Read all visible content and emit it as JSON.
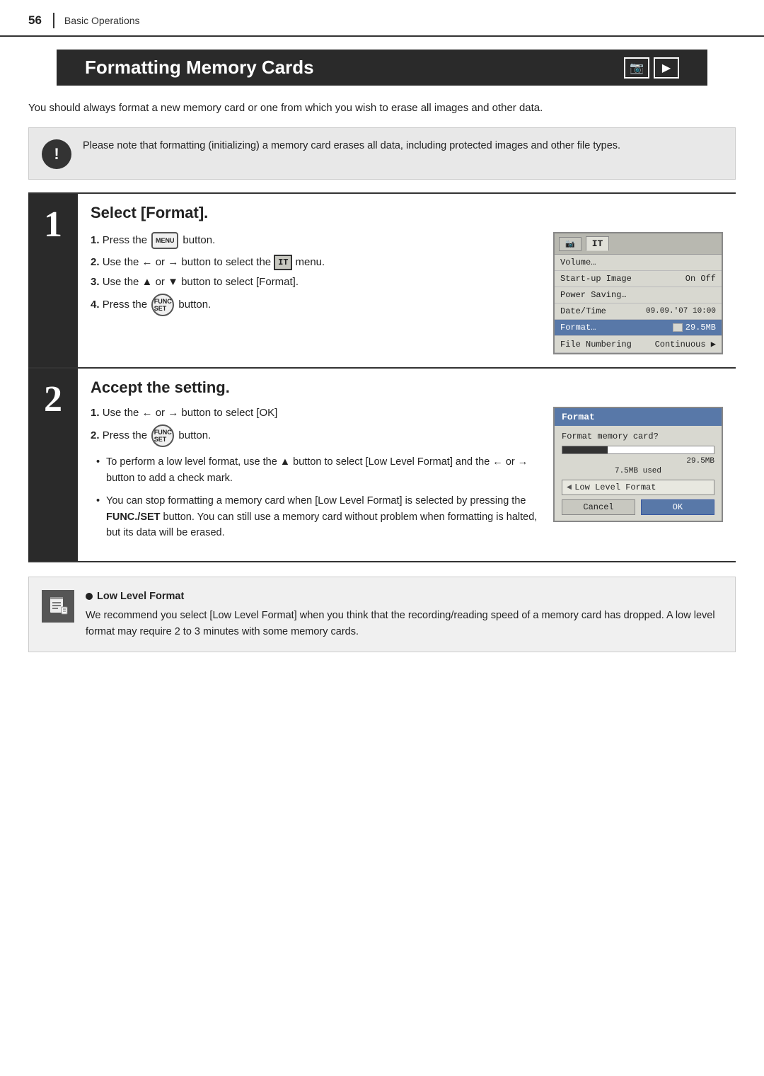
{
  "page": {
    "number": "56",
    "section": "Basic Operations"
  },
  "title": {
    "text": "Formatting Memory Cards",
    "camera_icon": "📷",
    "playback_icon": "▶"
  },
  "intro": {
    "text": "You should always format a new memory card or one from which you wish to erase all images and other data."
  },
  "warning": {
    "text": "Please note that formatting (initializing) a memory card erases all data, including protected images and other file types."
  },
  "step1": {
    "number": "1",
    "title": "Select [Format].",
    "instructions": [
      {
        "num": "1",
        "text_before": "Press the",
        "button": "MENU",
        "text_after": "button."
      },
      {
        "num": "2",
        "text_before": "Use the ← or → button to select the",
        "icon": "IT",
        "text_after": "menu."
      },
      {
        "num": "3",
        "text_before": "Use the ▲ or ▼ button to select [Format]."
      },
      {
        "num": "4",
        "text_before": "Press the",
        "button": "FUNC/SET",
        "text_after": "button."
      }
    ],
    "screen": {
      "tabs": [
        "📷",
        "IT"
      ],
      "active_tab": "IT",
      "menu_items": [
        {
          "label": "Volume…",
          "value": "",
          "selected": false
        },
        {
          "label": "Start-up Image",
          "value": "On  Off",
          "selected": false
        },
        {
          "label": "Power Saving…",
          "value": "",
          "selected": false
        },
        {
          "label": "Date/Time",
          "value": "09.09.'07 10:00",
          "selected": false
        },
        {
          "label": "Format…",
          "value": "□  29.5MB",
          "selected": true
        },
        {
          "label": "File Numbering",
          "value": "Continuous  ▶",
          "selected": false
        }
      ]
    }
  },
  "step2": {
    "number": "2",
    "title": "Accept the setting.",
    "instructions": [
      {
        "num": "1",
        "text": "Use the ← or → button to select [OK]"
      },
      {
        "num": "2",
        "text_before": "Press the",
        "button": "FUNC/SET",
        "text_after": "button."
      }
    ],
    "bullet_items": [
      {
        "text": "To perform a low level format, use the ▲ button to select [Low Level Format] and the ← or → button to add a check mark."
      },
      {
        "text": "You can stop formatting a memory card when [Low Level Format] is selected by pressing the FUNC./SET button. You can still use a memory card without problem when formatting is halted, but its data will be erased."
      }
    ],
    "dialog": {
      "title": "Format",
      "question": "Format memory card?",
      "size": "29.5MB",
      "used": "7.5MB used",
      "low_level_label": "Low Level Format",
      "cancel": "Cancel",
      "ok": "OK"
    }
  },
  "note": {
    "title": "Low Level Format",
    "text": "We recommend you select [Low Level Format] when you think that the recording/reading speed of a memory card has dropped. A low level format may require 2 to 3 minutes with some memory cards."
  }
}
